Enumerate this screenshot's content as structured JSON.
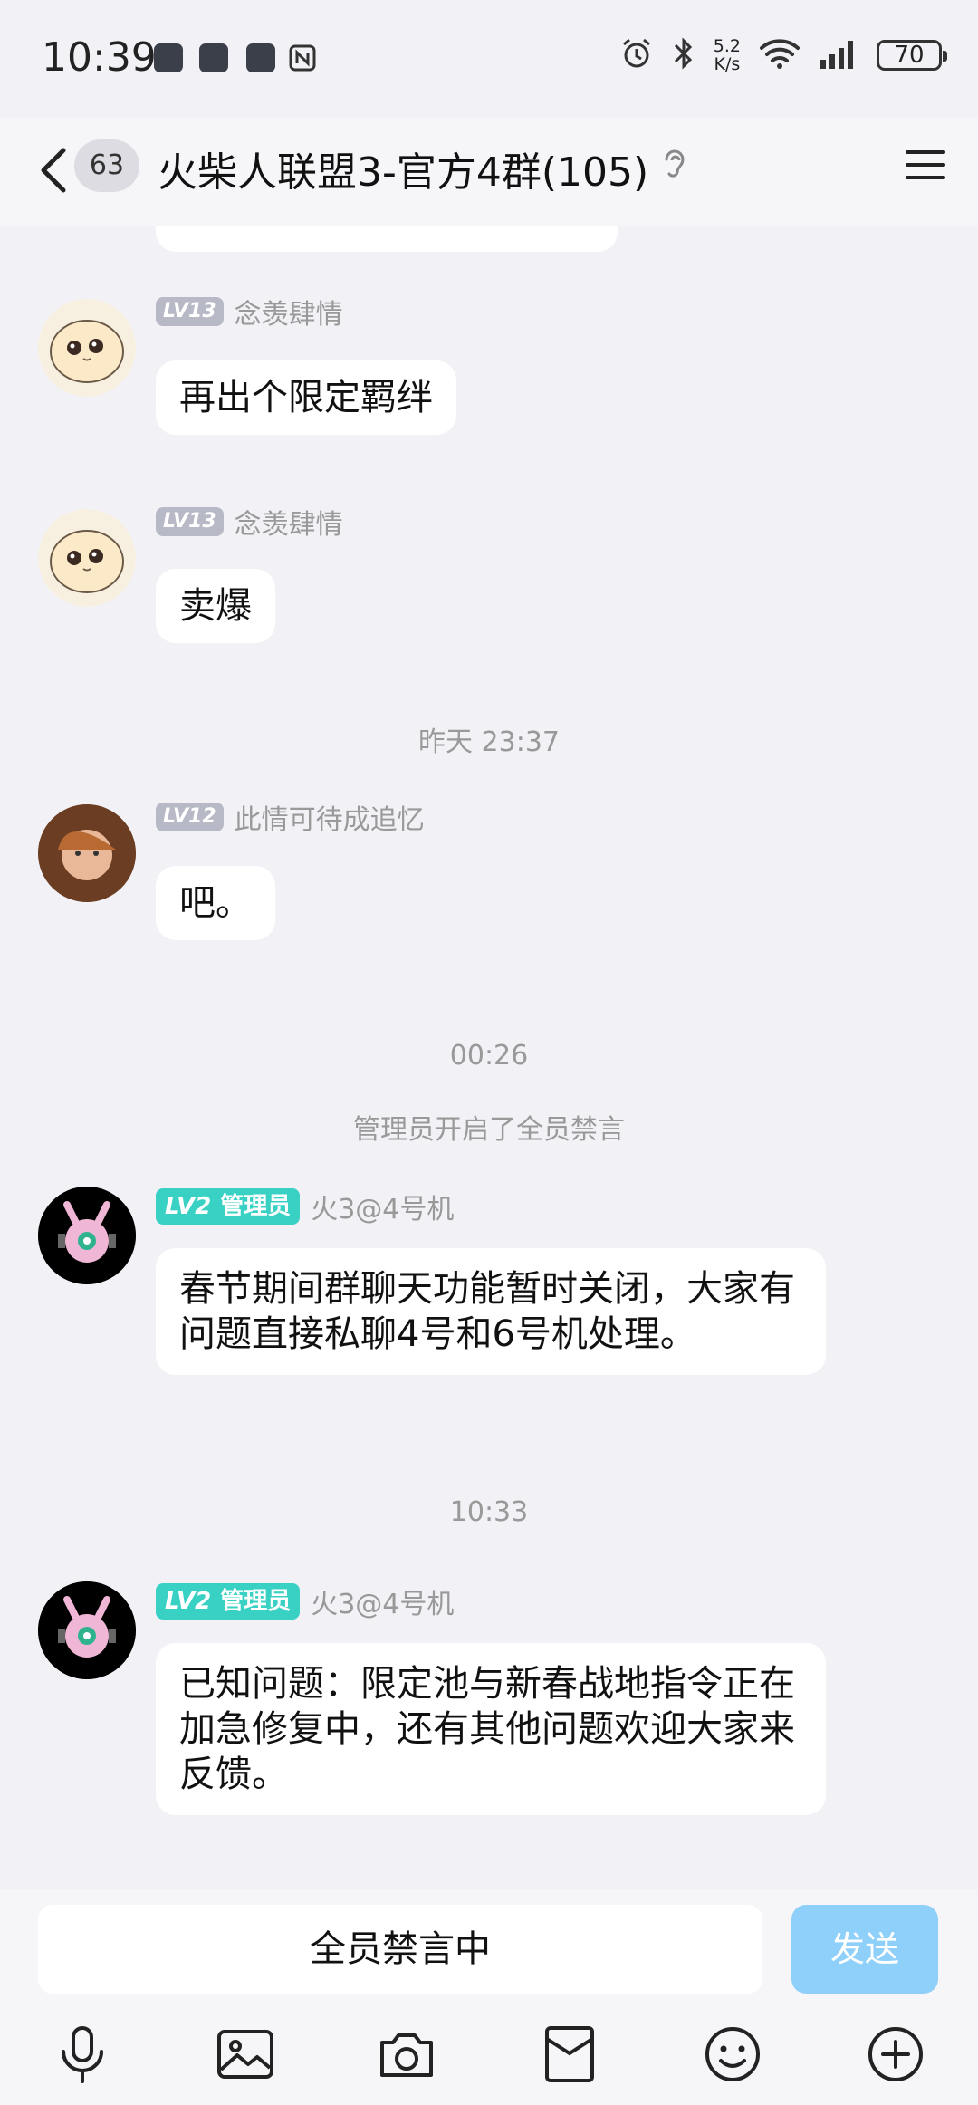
{
  "status_bar": {
    "time": "10:39",
    "net_speed_value": "5.2",
    "net_speed_unit": "K/s",
    "battery": "70"
  },
  "header": {
    "unread_count": "63",
    "title": "火柴人联盟3-官方4群(105)"
  },
  "messages": [
    {
      "level": "LV13",
      "name": "念羡肆情",
      "text": "再出个限定羁绊"
    },
    {
      "level": "LV13",
      "name": "念羡肆情",
      "text": "卖爆"
    },
    {
      "level": "LV12",
      "name": "此情可待成追忆",
      "text": "吧。"
    },
    {
      "level": "LV2",
      "role": "管理员",
      "name": "火3@4号机",
      "text": "春节期间群聊天功能暂时关闭，大家有问题直接私聊4号和6号机处理。"
    },
    {
      "level": "LV2",
      "role": "管理员",
      "name": "火3@4号机",
      "text": "已知问题：限定池与新春战地指令正在加急修复中，还有其他问题欢迎大家来反馈。"
    }
  ],
  "timestamps": [
    "昨天 23:37",
    "00:26",
    "10:33"
  ],
  "system_notice": "管理员开启了全员禁言",
  "input": {
    "placeholder": "全员禁言中",
    "send_label": "发送"
  },
  "toolbar_icons": [
    "microphone-icon",
    "image-icon",
    "camera-icon",
    "red-packet-icon",
    "emoji-icon",
    "plus-icon"
  ],
  "colors": {
    "background": "#f1f1f6",
    "admin_badge": "#3ad1c5",
    "level_badge": "#b8b9c6",
    "send_button": "#8fd0fb"
  }
}
